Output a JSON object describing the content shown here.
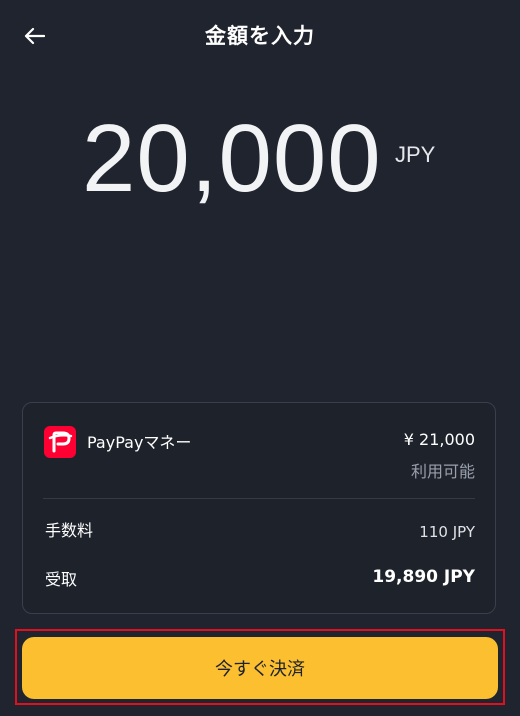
{
  "header": {
    "title": "金額を入力",
    "back_icon": "arrow-left-icon"
  },
  "amount": {
    "value": "20,000",
    "currency": "JPY"
  },
  "payment_card": {
    "method": {
      "name": "PayPayマネー",
      "icon": "paypay-logo",
      "brand_color": "#ff0033",
      "balance": "¥ 21,000",
      "availability": "利用可能"
    },
    "fee": {
      "label": "手数料",
      "value": "110 JPY"
    },
    "received": {
      "label": "受取",
      "value": "19,890 JPY"
    }
  },
  "pay_button": {
    "label": "今すぐ決済",
    "color": "#fbbf2f"
  },
  "colors": {
    "background": "#20242e",
    "highlight_border": "#e0101e"
  }
}
